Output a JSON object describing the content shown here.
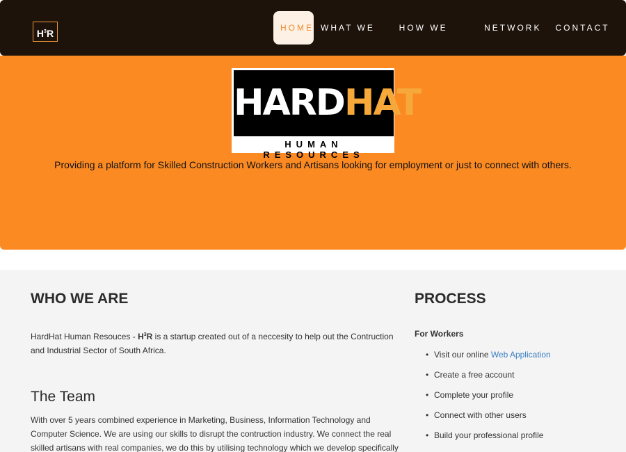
{
  "navbar": {
    "logo_text": "H³R",
    "links": [
      {
        "label": "HOME",
        "active": true
      },
      {
        "label": "WHAT WE DO",
        "active": false
      },
      {
        "label": "HOW WE HELP",
        "active": false
      },
      {
        "label": "NETWORK",
        "active": false
      },
      {
        "label": "CONTACT US",
        "active": false
      }
    ],
    "bg_color": "#1e130b",
    "accent_color": "#f08c2a"
  },
  "hero": {
    "brand_part1": "HARD",
    "brand_part2": "HAT",
    "brand_sub": "HUMAN RESOURCES",
    "tagline": "Providing a platform for Skilled Construction Workers and Artisans looking for employment or just to connect with others.",
    "bg_color": "#fb8a23"
  },
  "who": {
    "heading": "WHO WE ARE",
    "text_prefix": "HardHat Human Resouces - ",
    "brand_abbrev_h": "H",
    "brand_abbrev_sup": "3",
    "brand_abbrev_r": "R",
    "text_suffix": " is a startup created out of a neccesity to help out the Contruction and Industrial Sector of South Africa."
  },
  "team": {
    "heading": "The Team",
    "text": "With over 5 years combined experience in Marketing, Business, Information Technology and Computer Science. We are using our skills to disrupt the contruction industry. We connect the real skilled artisans with real companies, we do this by utilising technology which we develop specifically for this market"
  },
  "process": {
    "heading": "PROCESS",
    "subheading": "For Workers",
    "items": [
      {
        "text": "Visit our online ",
        "link": "Web Application"
      },
      {
        "text": "Create a free account",
        "link": ""
      },
      {
        "text": "Complete your profile",
        "link": ""
      },
      {
        "text": "Connect with other users",
        "link": ""
      },
      {
        "text": "Build your professional profile",
        "link": ""
      }
    ],
    "bullet": "•"
  }
}
